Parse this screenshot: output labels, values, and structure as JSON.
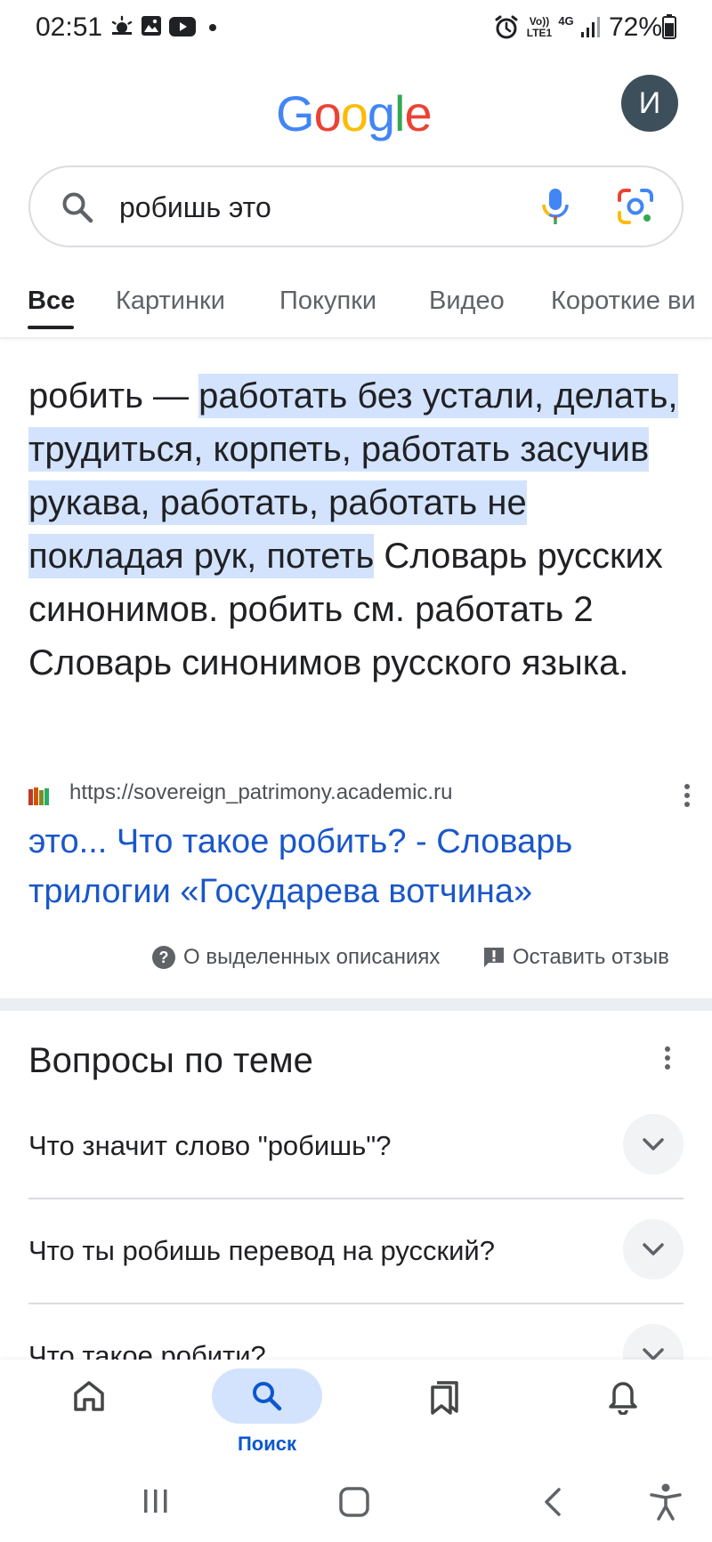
{
  "status_bar": {
    "time": "02:51",
    "network_volte": "Vo)) LTE1",
    "network_type": "4G",
    "battery": "72%",
    "left_icons": [
      "weather-icon",
      "gallery-icon",
      "youtube-icon",
      "dot-icon"
    ],
    "right_icons": [
      "alarm-icon",
      "signal-icon",
      "battery-icon"
    ]
  },
  "header": {
    "logo_letters": [
      "G",
      "o",
      "o",
      "g",
      "l",
      "e"
    ],
    "logo_colors": [
      "#4285F4",
      "#EA4335",
      "#FBBC05",
      "#4285F4",
      "#34A853",
      "#EA4335"
    ],
    "avatar_initial": "И",
    "avatar_color": "#3c4f5a"
  },
  "search": {
    "query": "робишь это"
  },
  "tabs": [
    {
      "label": "Все",
      "active": true
    },
    {
      "label": "Картинки",
      "active": false
    },
    {
      "label": "Покупки",
      "active": false
    },
    {
      "label": "Видео",
      "active": false
    },
    {
      "label": "Короткие ви",
      "active": false
    }
  ],
  "snippet": {
    "prefix": "робить — ",
    "highlight": "работать без устали, делать, трудиться, корпеть, работать засучив рукава, работать, работать не покладая рук, потеть",
    "rest": " Словарь русских синонимов. робить см. работать 2 Словарь синонимов русского языка.",
    "highlight_color": "#d3e3fd",
    "source_url": "https://sovereign_patrimony.academic.ru",
    "result_title": "это... Что такое робить? - Словарь трилогии «Государева вотчина»",
    "link_color": "#1a57c8"
  },
  "feedback": {
    "about_label": "О выделенных описаниях",
    "feedback_label": "Оставить отзыв"
  },
  "related": {
    "title": "Вопросы по теме",
    "questions": [
      "Что значит слово \"робишь\"?",
      "Что ты робишь перевод на русский?",
      "Что такое робити?"
    ]
  },
  "bottom_nav": {
    "items": [
      {
        "icon": "home-icon",
        "label": ""
      },
      {
        "icon": "search-icon",
        "label": "Поиск",
        "active": true
      },
      {
        "icon": "saved-icon",
        "label": ""
      },
      {
        "icon": "notifications-icon",
        "label": ""
      }
    ],
    "active_color": "#0b57d0"
  },
  "system_nav": [
    "recents-icon",
    "home-button-icon",
    "back-icon",
    "accessibility-icon"
  ]
}
